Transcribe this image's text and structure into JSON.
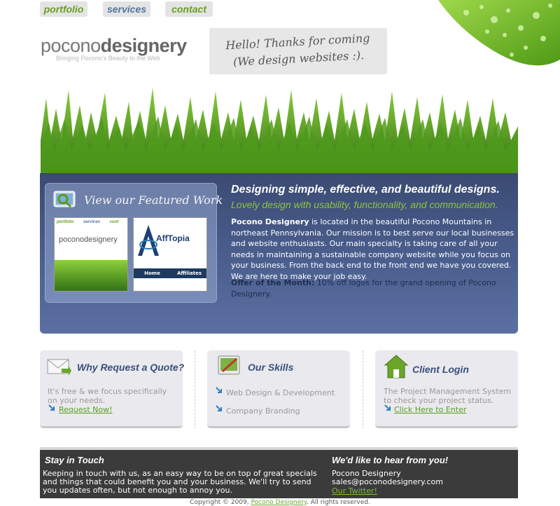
{
  "nav": {
    "portfolio": "portfolio",
    "services": "services",
    "contact": "contact"
  },
  "logo": {
    "light": "pocono",
    "bold": "designery",
    "tagline": "Bringing Pocono's Beauty to the Web"
  },
  "note": {
    "line1": "Hello! Thanks for coming",
    "line2": "(We design websites :)."
  },
  "featured": {
    "title": "View our Featured Work",
    "thumb1": {
      "tabs": [
        "portfolio",
        "services",
        "cont"
      ],
      "logo": "poconodesignery"
    },
    "thumb2": {
      "logo": "AffTopia",
      "buttons": [
        "Home",
        "Affiliates"
      ]
    }
  },
  "intro": {
    "headline": "Designing simple, effective, and beautiful designs.",
    "subhead": "Lovely design with usability, functionality, and communication.",
    "company": "Pocono Designery",
    "body": "is located in the beautiful Pocono Mountains in northeast Pennsylvania. Our mission is to best serve our local businesses and website enthusiasts. Our main specialty is taking care of all your needs in maintaining a sustainable company website while you focus on your business. From the back end to the front end we have you covered. We are here to make your job easy.",
    "offer_label": "Offer of the Month:",
    "offer_text": "10% off logos for the grand opening of Pocono Designery."
  },
  "quote": {
    "title": "Why Request a Quote?",
    "text": "It's free & we focus specifically on your needs.",
    "link": "Request Now!"
  },
  "skills": {
    "title": "Our Skills",
    "items": [
      "Web Design & Development",
      "Company Branding"
    ]
  },
  "login": {
    "title": "Client Login",
    "text": "The Project Management System to check your project status.",
    "link": "Click Here to Enter"
  },
  "footer": {
    "left_title": "Stay in Touch",
    "left_text": "Keeping in touch with us, as an easy way to be on top of great specials and things that could benefit you and your business. We'll try to send you updates often, but not enough to annoy you.",
    "right_title": "We'd like to hear from you!",
    "company": "Pocono Designery",
    "email": "sales@poconodesignery.com",
    "twitter": "Our Twitter!"
  },
  "copyright": {
    "prefix": "Copyright © 2009,",
    "link": "Pocono Designery",
    "suffix": ". All rights reserved."
  },
  "colors": {
    "accent_green": "#8dc63f",
    "nav_blue": "#52769e",
    "panel_blue": "#4b5f8f",
    "footer": "#3b3b3b"
  }
}
